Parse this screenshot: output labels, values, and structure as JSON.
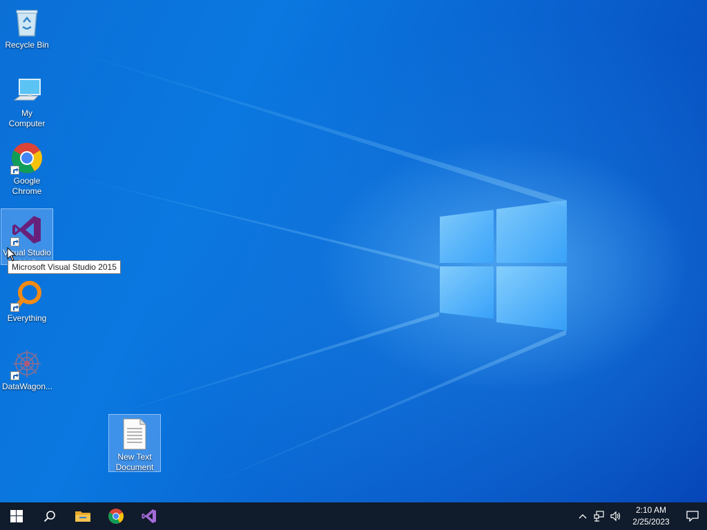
{
  "desktop": {
    "icons": [
      {
        "label": "Recycle Bin",
        "icon": "recycle-bin-icon"
      },
      {
        "label": "My Computer",
        "icon": "computer-icon"
      },
      {
        "label": "Google Chrome",
        "icon": "chrome-icon"
      },
      {
        "label": "Visual Studio 2015",
        "icon": "visual-studio-icon"
      },
      {
        "label": "Everything",
        "icon": "everything-search-icon"
      },
      {
        "label": "DataWagon...",
        "icon": "datawagon-icon"
      },
      {
        "label": "New Text Document",
        "icon": "text-document-icon"
      }
    ],
    "tooltip": "Microsoft Visual Studio 2015"
  },
  "taskbar": {
    "pinned": [
      {
        "name": "start",
        "icon": "windows-logo-icon"
      },
      {
        "name": "search",
        "icon": "search-icon"
      },
      {
        "name": "file-explorer",
        "icon": "folder-icon"
      },
      {
        "name": "chrome",
        "icon": "chrome-icon"
      },
      {
        "name": "visual-studio",
        "icon": "visual-studio-icon"
      }
    ],
    "clock": {
      "time": "2:10 AM",
      "date": "2/25/2023"
    }
  },
  "colors": {
    "accent": "#0a78e0",
    "taskbar": "#101b2b",
    "vs_purple": "#68217a"
  }
}
